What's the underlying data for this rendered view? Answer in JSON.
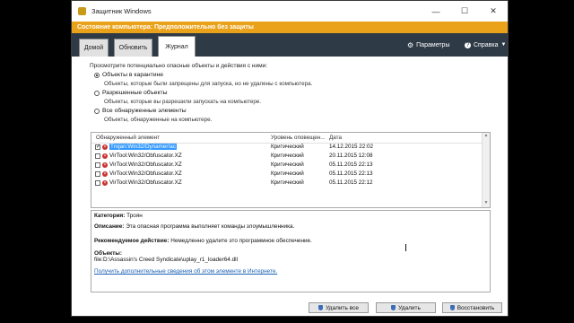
{
  "window": {
    "title": "Защитник Windows"
  },
  "status": {
    "text": "Состояние компьютера: Предположительно без защиты"
  },
  "tabs": [
    {
      "label": "Домой"
    },
    {
      "label": "Обновить"
    },
    {
      "label": "Журнал"
    }
  ],
  "toolbar": {
    "settings_label": "Параметры",
    "help_label": "Справка"
  },
  "intro": "Просмотрите потенциально опасные объекты и действия с ними:",
  "options": [
    {
      "label": "Объекты в карантине",
      "desc": "Объекты, которые были запрещены для запуска, но не удалены с компьютера.",
      "selected": true
    },
    {
      "label": "Разрешенные объекты",
      "desc": "Объекты, которые вы разрешили запускать на компьютере.",
      "selected": false
    },
    {
      "label": "Все обнаруженные элементы",
      "desc": "Объекты, обнаруженные на компьютере.",
      "selected": false
    }
  ],
  "list": {
    "headers": {
      "item": "Обнаруженный элемент",
      "level": "Уровень оповещен...",
      "date": "Дата"
    },
    "rows": [
      {
        "name": "Trojan:Win32/Dynamer!ac",
        "level": "Критический",
        "date": "14.12.2015 22:02",
        "checked": true,
        "selected": true
      },
      {
        "name": "VirTool:Win32/Obfuscator.XZ",
        "level": "Критический",
        "date": "20.11.2015 12:08",
        "checked": false,
        "selected": false
      },
      {
        "name": "VirTool:Win32/Obfuscator.XZ",
        "level": "Критический",
        "date": "05.11.2015 22:13",
        "checked": false,
        "selected": false
      },
      {
        "name": "VirTool:Win32/Obfuscator.XZ",
        "level": "Критический",
        "date": "05.11.2015 22:13",
        "checked": false,
        "selected": false
      },
      {
        "name": "VirTool:Win32/Obfuscator.XZ",
        "level": "Критический",
        "date": "05.11.2015 22:12",
        "checked": false,
        "selected": false
      }
    ]
  },
  "details": {
    "category_label": "Категория:",
    "category_value": "Троян",
    "description_label": "Описание:",
    "description_value": "Эта опасная программа выполняет команды злоумышленника.",
    "action_label": "Рекомендуемое действие:",
    "action_value": "Немедленно удалите это программное обеспечение.",
    "objects_label": "Объекты:",
    "objects_value": "file:D:\\Assassin's Creed Syndicate\\uplay_r1_loader64.dll",
    "more_info_link": "Получить дополнительные сведения об этом элементе в Интернете."
  },
  "buttons": {
    "delete_all": "Удалить все",
    "delete": "Удалить",
    "restore": "Восстановить"
  },
  "colors": {
    "status_bar": "#eaa21b",
    "tab_strip": "#2e3a46",
    "selection": "#3399ff"
  }
}
